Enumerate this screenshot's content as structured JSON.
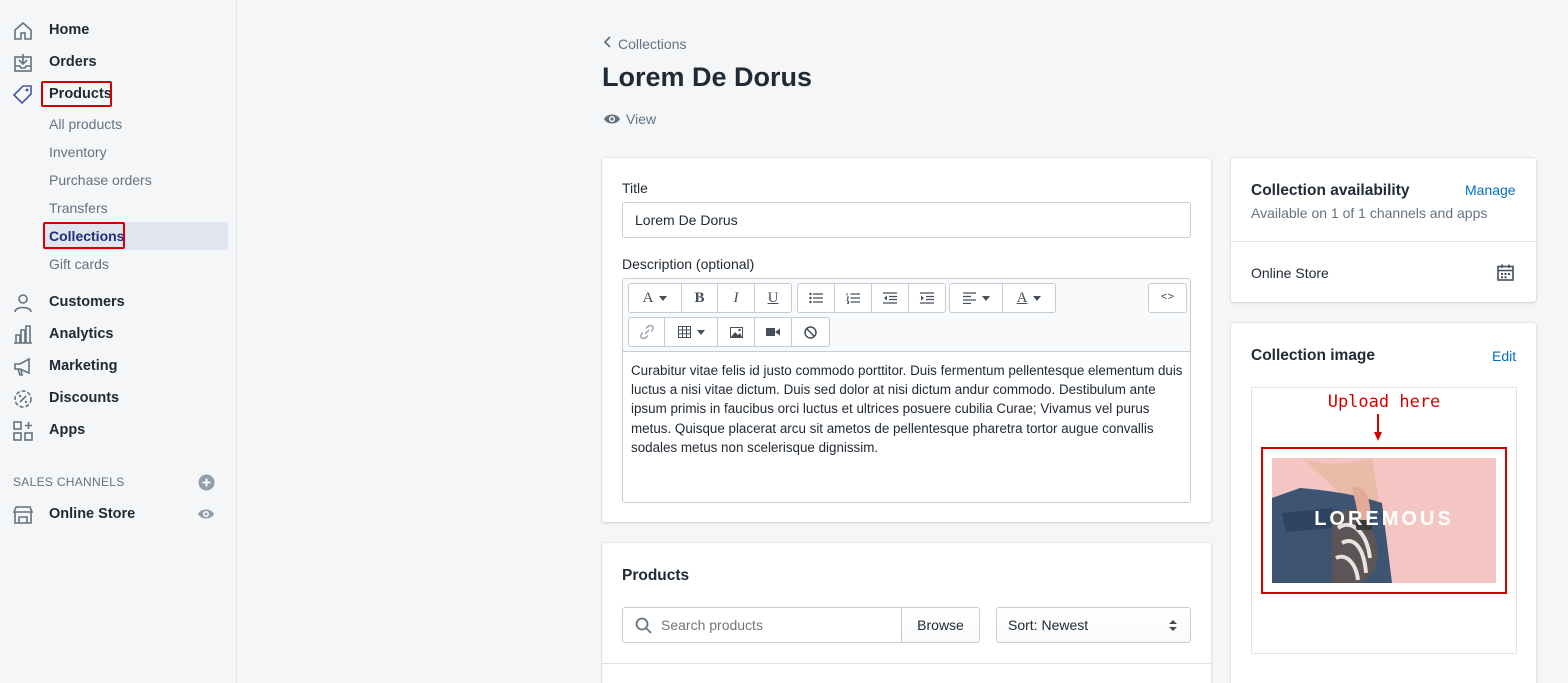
{
  "sidebar": {
    "nav": {
      "home": "Home",
      "orders": "Orders",
      "products": "Products",
      "customers": "Customers",
      "analytics": "Analytics",
      "marketing": "Marketing",
      "discounts": "Discounts",
      "apps": "Apps"
    },
    "products_sub": {
      "all_products": "All products",
      "inventory": "Inventory",
      "purchase_orders": "Purchase orders",
      "transfers": "Transfers",
      "collections": "Collections",
      "gift_cards": "Gift cards"
    },
    "sales_channels_title": "SALES CHANNELS",
    "online_store": "Online Store",
    "icons": [
      "home-icon",
      "orders-icon",
      "products-tag-icon",
      "customers-icon",
      "analytics-icon",
      "marketing-icon",
      "discounts-icon",
      "apps-icon",
      "online-store-icon",
      "add-channel-icon",
      "view-eye-icon"
    ]
  },
  "header": {
    "back_label": "Collections",
    "title": "Lorem De Dorus",
    "view_label": "View"
  },
  "details": {
    "title_label": "Title",
    "title_value": "Lorem De Dorus",
    "description_label": "Description (optional)",
    "description_text": "Curabitur vitae felis id justo commodo porttitor. Duis fermentum pellentesque elementum duis luctus a nisi vitae dictum. Duis sed dolor at nisi dictum andur commodo. Destibulum ante ipsum primis in faucibus orci luctus et ultrices posuere cubilia Curae; Vivamus vel purus metus. Quisque placerat arcu sit ametos de pellentesque pharetra tortor augue convallis sodales metus non scelerisque dignissim.",
    "toolbar": {
      "font": "A",
      "bold": "B",
      "italic": "I",
      "underline": "U",
      "color": "A",
      "html": "<>"
    }
  },
  "products_card": {
    "heading": "Products",
    "search_placeholder": "Search products",
    "browse_label": "Browse",
    "sort_value": "Sort: Newest"
  },
  "availability": {
    "heading": "Collection availability",
    "manage_label": "Manage",
    "subtitle": "Available on 1 of 1 channels and apps",
    "channel": "Online Store"
  },
  "collection_image": {
    "heading": "Collection image",
    "edit_label": "Edit",
    "annotation": "Upload here",
    "banner_text": "LOREMOUS"
  },
  "colors": {
    "accent": "#006fbb",
    "highlight": "#d40000",
    "active_nav": "#202e78",
    "banner": "#f3c6c4"
  }
}
